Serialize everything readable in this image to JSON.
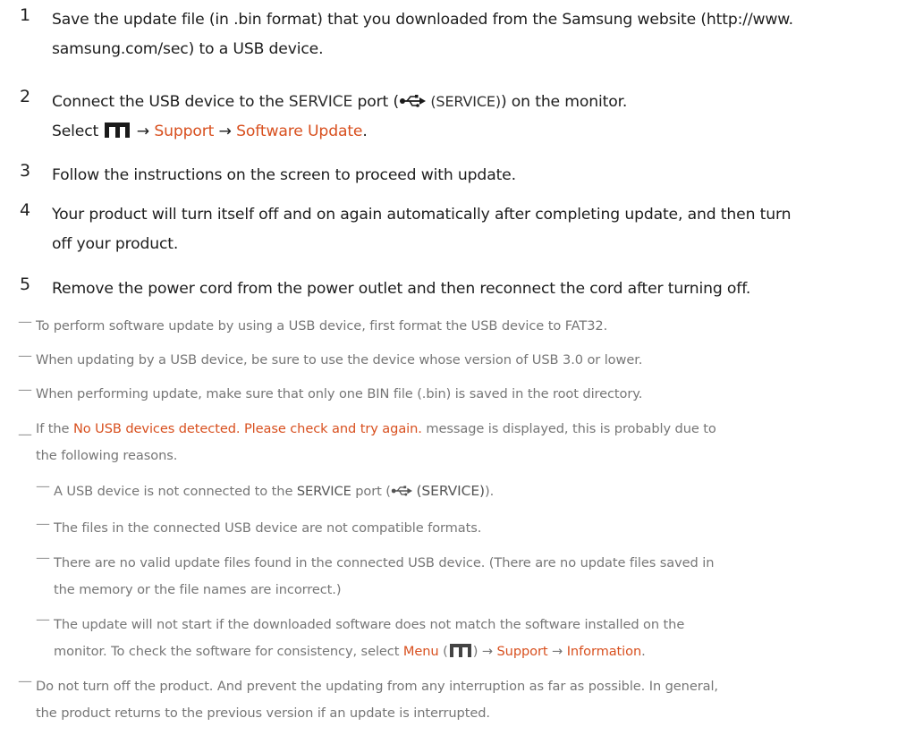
{
  "steps": [
    {
      "num": "1",
      "lines": [
        "Save the update file (in .bin format) that you downloaded from the Samsung website (http://www.",
        "samsung.com/sec) to a USB device."
      ]
    },
    {
      "num": "2",
      "line1_prefix": "Connect the USB device to the ",
      "line1_port": "SERVICE",
      "line1_mid": " port (",
      "line1_svc": "(SERVICE)",
      "line1_suffix": ") on the monitor.",
      "line2_prefix": "Select ",
      "line2_arrow1": " → ",
      "line2_support": "Support",
      "line2_arrow2": " → ",
      "line2_software": "Software Update",
      "line2_end": "."
    },
    {
      "num": "3",
      "lines": [
        "Follow the instructions on the screen to proceed with update."
      ]
    },
    {
      "num": "4",
      "lines": [
        "Your product will turn itself off and on again automatically after completing update, and then turn",
        "off your product."
      ]
    },
    {
      "num": "5",
      "lines": [
        "Remove the power cord from the power outlet and then reconnect the cord after turning off."
      ]
    }
  ],
  "notes": {
    "dash": "—",
    "fat32": "To perform software update by using a USB device, first format the USB device to FAT32.",
    "usb_version": "When updating by a USB device, be sure to use the device whose version of USB 3.0 or lower.",
    "one_bin": "When performing update, make sure that only one BIN file (.bin) is saved in the root directory.",
    "no_usb_prefix": "If the ",
    "no_usb_message": "No USB devices detected. Please check and try again.",
    "no_usb_suffix": " message is displayed, this is probably due to",
    "no_usb_line2": "the following reasons.",
    "sub_not_connected_prefix": "A USB device is not connected to the ",
    "sub_not_connected_port": "SERVICE",
    "sub_not_connected_mid": " port (",
    "sub_not_connected_svc": "(SERVICE)",
    "sub_not_connected_end": ").",
    "sub_not_compatible": "The files in the connected USB device are not compatible formats.",
    "sub_no_valid_1": "There are no valid update files found in the connected USB device. (There are no update files saved in",
    "sub_no_valid_2": "the memory or the file names are incorrect.)",
    "sub_mismatch_1": "The update will not start if the downloaded software does not match the software installed on the",
    "sub_mismatch_2_prefix": "monitor. To check the software for consistency, select ",
    "sub_mismatch_menu": "Menu",
    "sub_mismatch_paren_open": " (",
    "sub_mismatch_paren_close": ")",
    "sub_mismatch_arrow1": " → ",
    "sub_mismatch_support": "Support",
    "sub_mismatch_arrow2": " → ",
    "sub_mismatch_information": "Information",
    "sub_mismatch_end": ".",
    "no_turn_off_1": "Do not turn off the product. And prevent the updating from any interruption as far as possible. In general,",
    "no_turn_off_2": "the product returns to the previous version if an update is interrupted."
  },
  "icons": {
    "menu": "menu-icon",
    "usb": "usb-icon"
  },
  "colors": {
    "highlight": "#d8501f",
    "text": "#1d1d1d",
    "note_text": "#767676"
  }
}
